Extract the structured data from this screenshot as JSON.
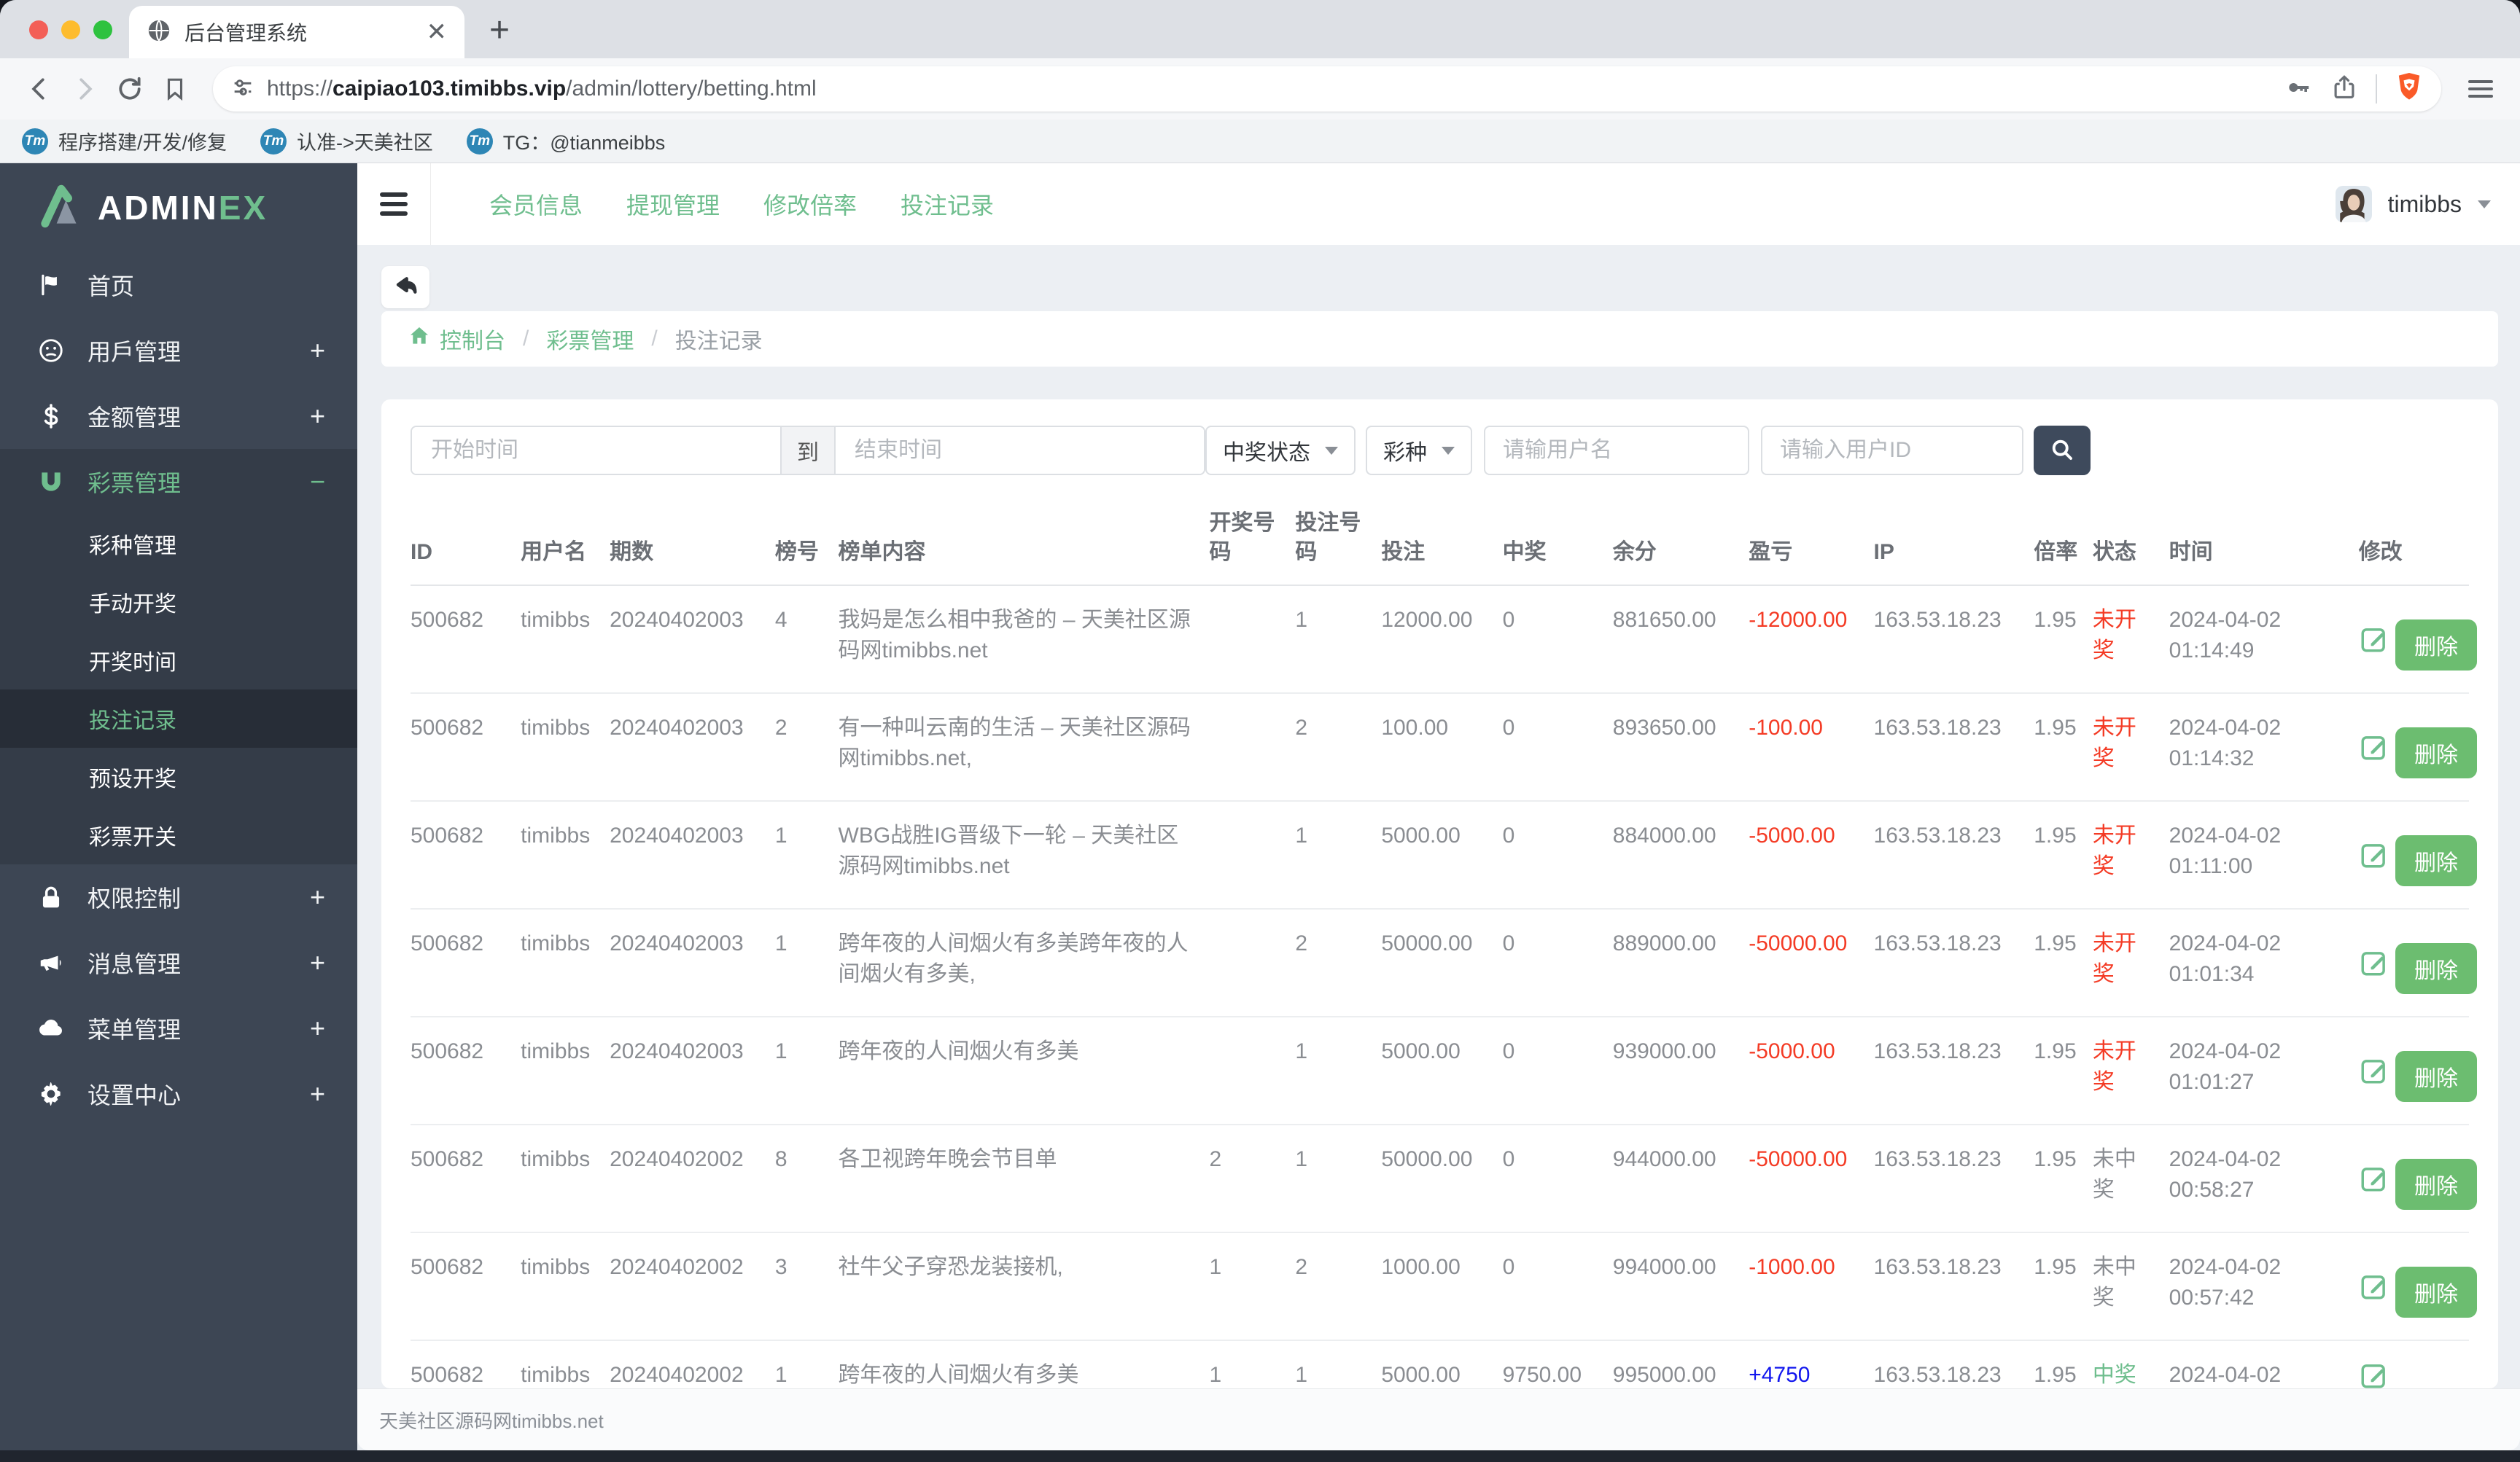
{
  "browser": {
    "tab_title": "后台管理系统",
    "url": {
      "scheme": "https://",
      "domain": "caipiao103.timibbs.vip",
      "path": "/admin/lottery/betting.html"
    },
    "bookmarks": [
      {
        "label": "程序搭建/开发/修复"
      },
      {
        "label": "认准->天美社区"
      },
      {
        "label": "TG：@tianmeibbs"
      }
    ]
  },
  "sidebar": {
    "logo_primary": "ADMIN",
    "logo_accent": "EX",
    "menu": [
      {
        "label": "首页",
        "icon": "flag"
      },
      {
        "label": "用戶管理",
        "icon": "sad-face",
        "suffix": "+"
      },
      {
        "label": "金额管理",
        "icon": "dollar",
        "suffix": "+"
      },
      {
        "label": "彩票管理",
        "icon": "magnet",
        "suffix": "−",
        "open": true,
        "children": [
          {
            "label": "彩种管理"
          },
          {
            "label": "手动开奖"
          },
          {
            "label": "开奖时间"
          },
          {
            "label": "投注记录",
            "active": true
          },
          {
            "label": "预设开奖"
          },
          {
            "label": "彩票开关"
          }
        ]
      },
      {
        "label": "权限控制",
        "icon": "lock",
        "suffix": "+"
      },
      {
        "label": "消息管理",
        "icon": "megaphone",
        "suffix": "+"
      },
      {
        "label": "菜单管理",
        "icon": "cloud",
        "suffix": "+"
      },
      {
        "label": "设置中心",
        "icon": "gear",
        "suffix": "+"
      }
    ]
  },
  "topnav": {
    "links": [
      {
        "label": "会员信息"
      },
      {
        "label": "提现管理"
      },
      {
        "label": "修改倍率"
      },
      {
        "label": "投注记录"
      }
    ],
    "user": {
      "name": "timibbs"
    }
  },
  "breadcrumb": {
    "home": "控制台",
    "section": "彩票管理",
    "current": "投注记录",
    "separator": "/"
  },
  "filters": {
    "start_time_placeholder": "开始时间",
    "to_label": "到",
    "end_time_placeholder": "结束时间",
    "win_status_select": "中奖状态",
    "lottery_type_select": "彩种",
    "username_placeholder": "请输用户名",
    "userid_placeholder": "请输入用户ID"
  },
  "table": {
    "columns": [
      "ID",
      "用户名",
      "期数",
      "榜号",
      "榜单内容",
      "开奖号码",
      "投注号码",
      "投注",
      "中奖",
      "余分",
      "盈亏",
      "IP",
      "倍率",
      "状态",
      "时间",
      "修改"
    ],
    "delete_label": "删除",
    "rows": [
      {
        "id": "500682",
        "user": "timibbs",
        "issue": "20240402003",
        "rank": "4",
        "content": "我妈是怎么相中我爸的 – 天美社区源码网timibbs.net",
        "draw_no": "",
        "bet_no": "1",
        "bet": "12000.00",
        "win": "0",
        "balance": "881650.00",
        "profit": "-12000.00",
        "profit_color": "red",
        "ip": "163.53.18.23",
        "rate": "1.95",
        "status": "未开奖",
        "status_color": "red",
        "time": "2024-04-02 01:14:49",
        "show_delete": true
      },
      {
        "id": "500682",
        "user": "timibbs",
        "issue": "20240402003",
        "rank": "2",
        "content": "有一种叫云南的生活 – 天美社区源码网timibbs.net,",
        "draw_no": "",
        "bet_no": "2",
        "bet": "100.00",
        "win": "0",
        "balance": "893650.00",
        "profit": "-100.00",
        "profit_color": "red",
        "ip": "163.53.18.23",
        "rate": "1.95",
        "status": "未开奖",
        "status_color": "red",
        "time": "2024-04-02 01:14:32",
        "show_delete": true
      },
      {
        "id": "500682",
        "user": "timibbs",
        "issue": "20240402003",
        "rank": "1",
        "content": "WBG战胜IG晋级下一轮 – 天美社区源码网timibbs.net",
        "draw_no": "",
        "bet_no": "1",
        "bet": "5000.00",
        "win": "0",
        "balance": "884000.00",
        "profit": "-5000.00",
        "profit_color": "red",
        "ip": "163.53.18.23",
        "rate": "1.95",
        "status": "未开奖",
        "status_color": "red",
        "time": "2024-04-02 01:11:00",
        "show_delete": true
      },
      {
        "id": "500682",
        "user": "timibbs",
        "issue": "20240402003",
        "rank": "1",
        "content": "跨年夜的人间烟火有多美跨年夜的人间烟火有多美,",
        "draw_no": "",
        "bet_no": "2",
        "bet": "50000.00",
        "win": "0",
        "balance": "889000.00",
        "profit": "-50000.00",
        "profit_color": "red",
        "ip": "163.53.18.23",
        "rate": "1.95",
        "status": "未开奖",
        "status_color": "red",
        "time": "2024-04-02 01:01:34",
        "show_delete": true
      },
      {
        "id": "500682",
        "user": "timibbs",
        "issue": "20240402003",
        "rank": "1",
        "content": "跨年夜的人间烟火有多美",
        "draw_no": "",
        "bet_no": "1",
        "bet": "5000.00",
        "win": "0",
        "balance": "939000.00",
        "profit": "-5000.00",
        "profit_color": "red",
        "ip": "163.53.18.23",
        "rate": "1.95",
        "status": "未开奖",
        "status_color": "red",
        "time": "2024-04-02 01:01:27",
        "show_delete": true
      },
      {
        "id": "500682",
        "user": "timibbs",
        "issue": "20240402002",
        "rank": "8",
        "content": "各卫视跨年晚会节目单",
        "draw_no": "2",
        "bet_no": "1",
        "bet": "50000.00",
        "win": "0",
        "balance": "944000.00",
        "profit": "-50000.00",
        "profit_color": "red",
        "ip": "163.53.18.23",
        "rate": "1.95",
        "status": "未中奖",
        "status_color": "gray",
        "time": "2024-04-02 00:58:27",
        "show_delete": true
      },
      {
        "id": "500682",
        "user": "timibbs",
        "issue": "20240402002",
        "rank": "3",
        "content": "社牛父子穿恐龙装接机,",
        "draw_no": "1",
        "bet_no": "2",
        "bet": "1000.00",
        "win": "0",
        "balance": "994000.00",
        "profit": "-1000.00",
        "profit_color": "red",
        "ip": "163.53.18.23",
        "rate": "1.95",
        "status": "未中奖",
        "status_color": "gray",
        "time": "2024-04-02 00:57:42",
        "show_delete": true
      },
      {
        "id": "500682",
        "user": "timibbs",
        "issue": "20240402002",
        "rank": "1",
        "content": "跨年夜的人间烟火有多美",
        "draw_no": "1",
        "bet_no": "1",
        "bet": "5000.00",
        "win": "9750.00",
        "balance": "995000.00",
        "profit": "+4750",
        "profit_color": "blue",
        "ip": "163.53.18.23",
        "rate": "1.95",
        "status": "中奖",
        "status_color": "green",
        "time": "2024-04-02",
        "show_delete": false
      }
    ]
  },
  "footer": {
    "text": "天美社区源码网timibbs.net"
  },
  "colors": {
    "accent_green": "#6fbe8e",
    "delete_button_green": "#6cbd70",
    "loss_red": "#f43b25",
    "win_blue": "#1217ee",
    "sidebar_bg": "#3d4654",
    "search_button_bg": "#3e4a5c",
    "brave_orange": "#fa5a28"
  }
}
